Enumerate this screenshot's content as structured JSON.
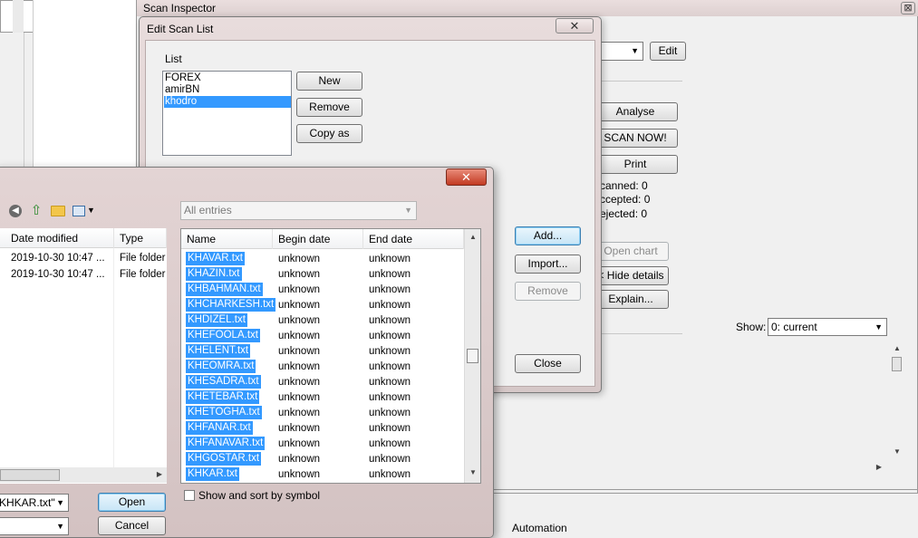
{
  "scan_inspector": {
    "title": "Scan Inspector",
    "close_label": "⊠",
    "edit_label": "Edit",
    "analyse_label": "Analyse",
    "scan_now_label": "SCAN NOW!",
    "print_label": "Print",
    "scanned_text": "canned: 0",
    "accepted_text": "ccepted: 0",
    "rejected_text": "ejected: 0",
    "open_chart_label": "Open chart",
    "hide_details_label": "< Hide details",
    "explain_label": "Explain...",
    "show_label": "Show:",
    "show_value": "0: current",
    "bottom_tab": "Automation"
  },
  "edit_scan_list": {
    "title": "Edit Scan List",
    "close_label": "✕",
    "list_label": "List",
    "lists": [
      "FOREX",
      "amirBN",
      "khodro"
    ],
    "selected_list": "khodro",
    "new_label": "New",
    "remove_label": "Remove",
    "copy_as_label": "Copy as",
    "add_label": "Add...",
    "import_label": "Import...",
    "remove2_label": "Remove",
    "close_label2": "Close"
  },
  "file_dialog": {
    "close_label": "✕",
    "filter_value": "All entries",
    "left_columns": [
      "Date modified",
      "Type"
    ],
    "left_rows": [
      {
        "date": "2019-10-30 10:47 ...",
        "type": "File folder"
      },
      {
        "date": "2019-10-30 10:47 ...",
        "type": "File folder"
      }
    ],
    "columns": [
      "Name",
      "Begin date",
      "End date"
    ],
    "rows": [
      {
        "name": "KHAVAR.txt",
        "begin": "unknown",
        "end": "unknown"
      },
      {
        "name": "KHAZIN.txt",
        "begin": "unknown",
        "end": "unknown"
      },
      {
        "name": "KHBAHMAN.txt",
        "begin": "unknown",
        "end": "unknown"
      },
      {
        "name": "KHCHARKESH.txt",
        "begin": "unknown",
        "end": "unknown"
      },
      {
        "name": "KHDIZEL.txt",
        "begin": "unknown",
        "end": "unknown"
      },
      {
        "name": "KHEFOOLA.txt",
        "begin": "unknown",
        "end": "unknown"
      },
      {
        "name": "KHELENT.txt",
        "begin": "unknown",
        "end": "unknown"
      },
      {
        "name": "KHEOMRA.txt",
        "begin": "unknown",
        "end": "unknown"
      },
      {
        "name": "KHESADRA.txt",
        "begin": "unknown",
        "end": "unknown"
      },
      {
        "name": "KHETEBAR.txt",
        "begin": "unknown",
        "end": "unknown"
      },
      {
        "name": "KHETOGHA.txt",
        "begin": "unknown",
        "end": "unknown"
      },
      {
        "name": "KHFANAR.txt",
        "begin": "unknown",
        "end": "unknown"
      },
      {
        "name": "KHFANAVAR.txt",
        "begin": "unknown",
        "end": "unknown"
      },
      {
        "name": "KHGOSTAR.txt",
        "begin": "unknown",
        "end": "unknown"
      },
      {
        "name": "KHKAR.txt",
        "begin": "unknown",
        "end": "unknown"
      }
    ],
    "show_sort_label": "Show and sort by symbol",
    "filename_value": "KHKAR.txt\"",
    "open_label": "Open",
    "cancel_label": "Cancel"
  }
}
